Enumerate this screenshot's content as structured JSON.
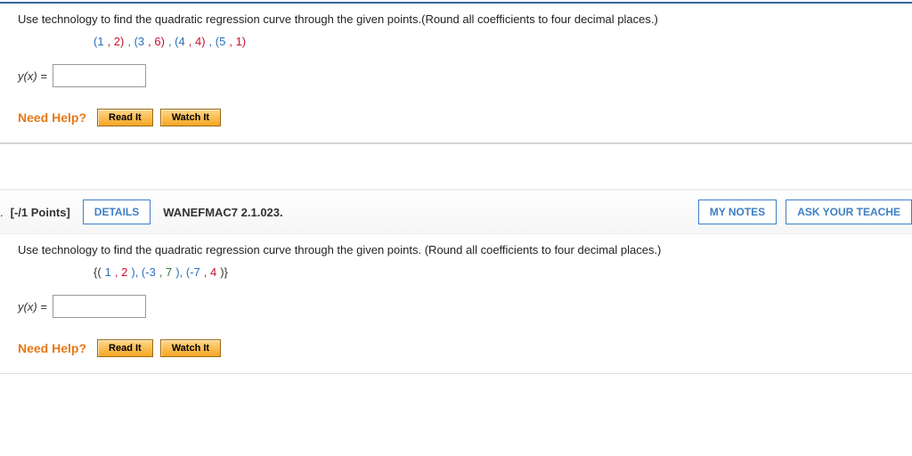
{
  "q1": {
    "prompt": "Use technology to find the quadratic regression curve through the given points.(Round all coefficients to four decimal places.)",
    "points_display": {
      "p1a": "(1",
      "p1b": ", 2)",
      "p2a": ", (3",
      "p2b": ", 6)",
      "p3a": ", (4",
      "p3b": ", 4)",
      "p4a": ", (5",
      "p4b": ", 1)"
    },
    "answer_label": "y(x) =",
    "answer_value": "",
    "need_help": "Need Help?",
    "read_it": "Read It",
    "watch_it": "Watch It"
  },
  "header": {
    "dot": ".",
    "points": "[-/1 Points]",
    "details": "DETAILS",
    "ref": "WANEFMAC7 2.1.023.",
    "my_notes": "MY NOTES",
    "ask": "ASK YOUR TEACHE"
  },
  "q2": {
    "prompt": "Use technology to find the quadratic regression curve through the given points. (Round all coefficients to four decimal places.)",
    "points_display": {
      "open": "{(",
      "p1a": "1",
      "p1b": ", 2",
      "p2a": "), (-3",
      "p2b": ", 7",
      "p3a": "), (-7",
      "p3b": ", 4",
      "close": ")}"
    },
    "answer_label": "y(x) =",
    "answer_value": "",
    "need_help": "Need Help?",
    "read_it": "Read It",
    "watch_it": "Watch It"
  }
}
